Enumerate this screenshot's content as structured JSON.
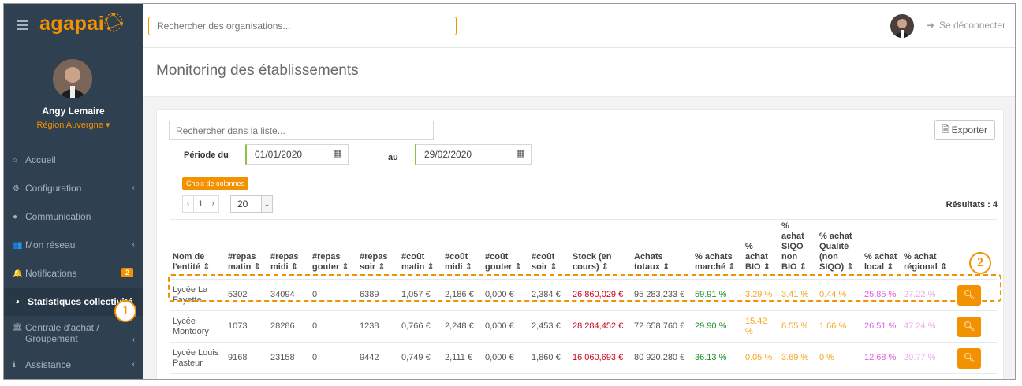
{
  "app": {
    "logo": "agapai",
    "org_search_placeholder": "Rechercher des organisations...",
    "logout_label": "Se déconnecter"
  },
  "user": {
    "name": "Angy Lemaire",
    "region": "Région Auvergne ▾"
  },
  "sidebar": {
    "items": [
      {
        "label": "Accueil",
        "icon": "home-icon",
        "glyph": "⌂",
        "chevron": "",
        "badge": ""
      },
      {
        "label": "Configuration",
        "icon": "gears-icon",
        "glyph": "⚙",
        "chevron": "‹",
        "badge": ""
      },
      {
        "label": "Communication",
        "icon": "comments-icon",
        "glyph": "●",
        "chevron": "",
        "badge": ""
      },
      {
        "label": "Mon réseau",
        "icon": "users-icon",
        "glyph": "👥",
        "chevron": "‹",
        "badge": ""
      },
      {
        "label": "Notifications",
        "icon": "bell-icon",
        "glyph": "🔔",
        "chevron": "",
        "badge": "2"
      },
      {
        "label": "Statistiques collectivité",
        "icon": "pie-chart-icon",
        "glyph": "◕",
        "chevron": "",
        "badge": ""
      },
      {
        "label": "Centrale d'achat / Groupement",
        "icon": "bank-icon",
        "glyph": "🏛",
        "chevron": "‹",
        "badge": ""
      },
      {
        "label": "Assistance",
        "icon": "info-icon",
        "glyph": "ℹ",
        "chevron": "‹",
        "badge": ""
      }
    ]
  },
  "page": {
    "title": "Monitoring des établissements",
    "list_search_placeholder": "Rechercher dans la liste...",
    "export_label": "Exporter",
    "period_label": "Période du",
    "date_from": "01/01/2020",
    "au_label": "au",
    "date_to": "29/02/2020",
    "columns_button": "Choix de colonnes",
    "pager": {
      "prev": "‹",
      "current": "1",
      "next": "›"
    },
    "page_size": "20",
    "results": "Résultats : 4"
  },
  "table": {
    "headers": [
      "Nom de l'entité ⇕",
      "#repas matin ⇕",
      "#repas midi ⇕",
      "#repas gouter ⇕",
      "#repas soir ⇕",
      "#coût matin ⇕",
      "#coût midi ⇕",
      "#coût gouter ⇕",
      "#coût soir ⇕",
      "Stock (en cours) ⇕",
      "Achats totaux ⇕",
      "% achats marché ⇕",
      "% achat BIO ⇕",
      "% achat SIQO non BIO ⇕",
      "% achat Qualité (non SIQO) ⇕",
      "% achat local ⇕",
      "% achat régional ⇕"
    ],
    "rows": [
      [
        "Lycée La Fayette",
        "5302",
        "34094",
        "0",
        "6389",
        "1,057 €",
        "2,186 €",
        "0,000 €",
        "2,384 €",
        "26 860,029 €",
        "95 283,233 €",
        "59.91 %",
        "3.29 %",
        "3.41 %",
        "0.44 %",
        "25.85 %",
        "27.22 %"
      ],
      [
        "Lycée Montdory",
        "1073",
        "28286",
        "0",
        "1238",
        "0,766 €",
        "2,248 €",
        "0,000 €",
        "2,453 €",
        "28 284,452 €",
        "72 658,760 €",
        "29.90 %",
        "15.42 %",
        "8.55 %",
        "1.66 %",
        "26.51 %",
        "47.24 %"
      ],
      [
        "Lycée Louis Pasteur",
        "9168",
        "23158",
        "0",
        "9442",
        "0,749 €",
        "2,111 €",
        "0,000 €",
        "1,860 €",
        "16 060,693 €",
        "80 920,280 €",
        "36.13 %",
        "0.05 %",
        "3.69 %",
        "0 %",
        "12.68 %",
        "20.77 %"
      ]
    ]
  },
  "annotations": {
    "callout_1": "1",
    "callout_2": "2"
  },
  "colors": {
    "accent": "#f39200",
    "sidebar_bg": "#2f4050",
    "stock_red": "#d0021b",
    "market_green": "#1c8e2a"
  }
}
